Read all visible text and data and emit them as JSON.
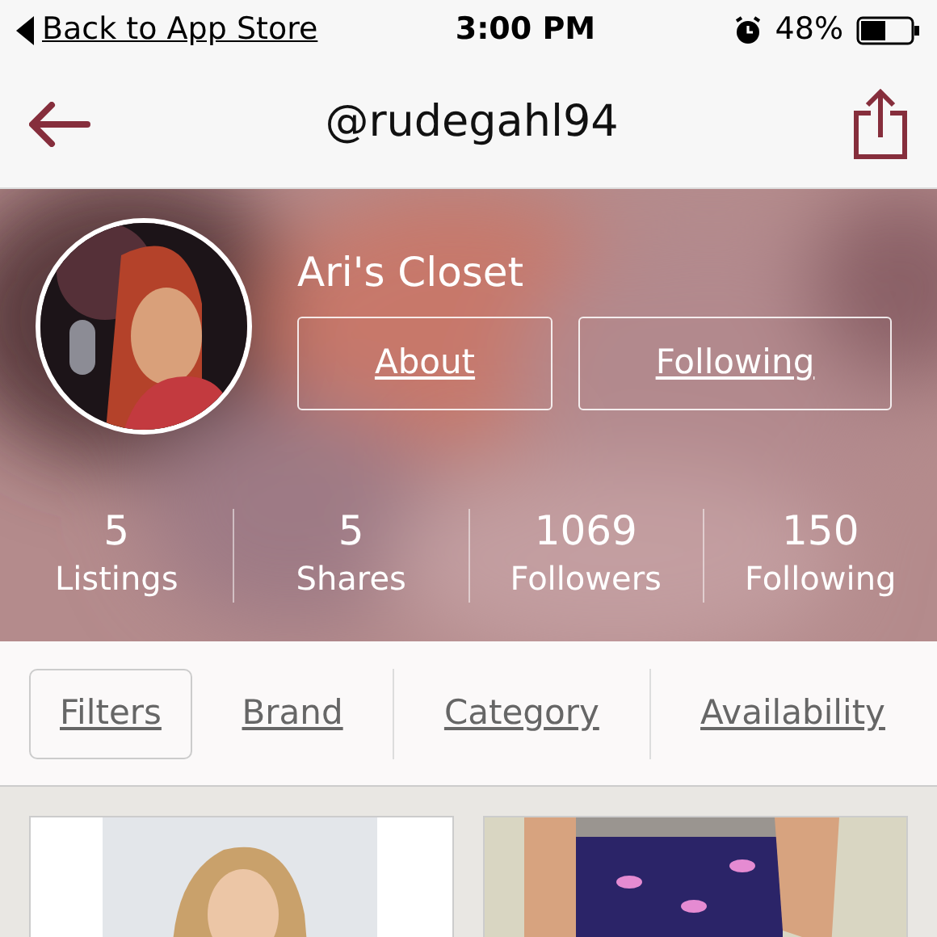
{
  "status_bar": {
    "back_label": "Back to App Store",
    "time": "3:00 PM",
    "battery": "48%"
  },
  "nav": {
    "title": "@rudegahl94"
  },
  "profile": {
    "name": "Ari's Closet",
    "buttons": [
      "About",
      "Following"
    ],
    "stats": [
      {
        "value": "5",
        "label": "Listings"
      },
      {
        "value": "5",
        "label": "Shares"
      },
      {
        "value": "1069",
        "label": "Followers"
      },
      {
        "value": "150",
        "label": "Following"
      }
    ]
  },
  "filters": [
    {
      "label": "Filters",
      "kind": "button"
    },
    {
      "label": "Brand",
      "kind": "menu"
    },
    {
      "label": "Category",
      "kind": "menu"
    },
    {
      "label": "Availability",
      "kind": "menu"
    }
  ]
}
